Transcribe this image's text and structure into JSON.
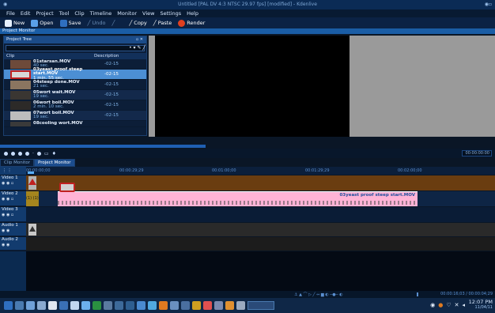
{
  "window": {
    "title": "Untitled [PAL DV 4:3 NTSC 29.97 fps] [modified] - Kdenlive"
  },
  "menu": [
    "File",
    "Edit",
    "Project",
    "Tool",
    "Clip",
    "Timeline",
    "Monitor",
    "View",
    "Settings",
    "Help"
  ],
  "toolbar": {
    "new": "New",
    "open": "Open",
    "save": "Save",
    "undo": "Undo",
    "copy": "Copy",
    "paste": "Paste",
    "render": "Render"
  },
  "dock_title": "Project Monitor",
  "project_tree": {
    "title": "Project Tree",
    "columns": {
      "clip": "Clip",
      "description": "Description"
    },
    "clips": [
      {
        "name": "01starsan.MOV",
        "duration": "40 sec.",
        "desc": "-02-15"
      },
      {
        "name": "03yeast proof steep start.MOV",
        "duration": "1 min. 55 sec.",
        "desc": "-02-15",
        "selected": true
      },
      {
        "name": "04steep done.MOV",
        "duration": "21 sec.",
        "desc": "-02-15"
      },
      {
        "name": "05wort wait.MOV",
        "duration": "19 sec.",
        "desc": "-02-15"
      },
      {
        "name": "06wort boil.MOV",
        "duration": "2 min. 10 sec.",
        "desc": "-02-15"
      },
      {
        "name": "07wort boil.MOV",
        "duration": "19 sec.",
        "desc": "-02-15"
      },
      {
        "name": "08cooling wort.MOV",
        "duration": "",
        "desc": ""
      }
    ]
  },
  "monitor_timecode": "00:00:00:00",
  "tabs": [
    "Clip Monitor",
    "Project Monitor"
  ],
  "ruler": [
    "00:00:00;00",
    "00:00:29;29",
    "00:01:00;00",
    "00:01:29;29",
    "00:02:00;00"
  ],
  "tracks": [
    {
      "name": "Video 1"
    },
    {
      "name": "Video 2"
    },
    {
      "name": "Video 3"
    },
    {
      "name": "Audio 1"
    },
    {
      "name": "Audio 2"
    }
  ],
  "timeline_clip_label": "03yeast proof steep start.MOV",
  "bottom_timecode": "00:00:16;03 / 00:00:04;29",
  "clock": {
    "time": "12:07 PM",
    "date": "11/04/11"
  },
  "colors": {
    "accent": "#1a5da5",
    "selection": "#4c8fd4",
    "clip_pink": "#ffb3d6",
    "track_brown": "#6a3d10"
  }
}
